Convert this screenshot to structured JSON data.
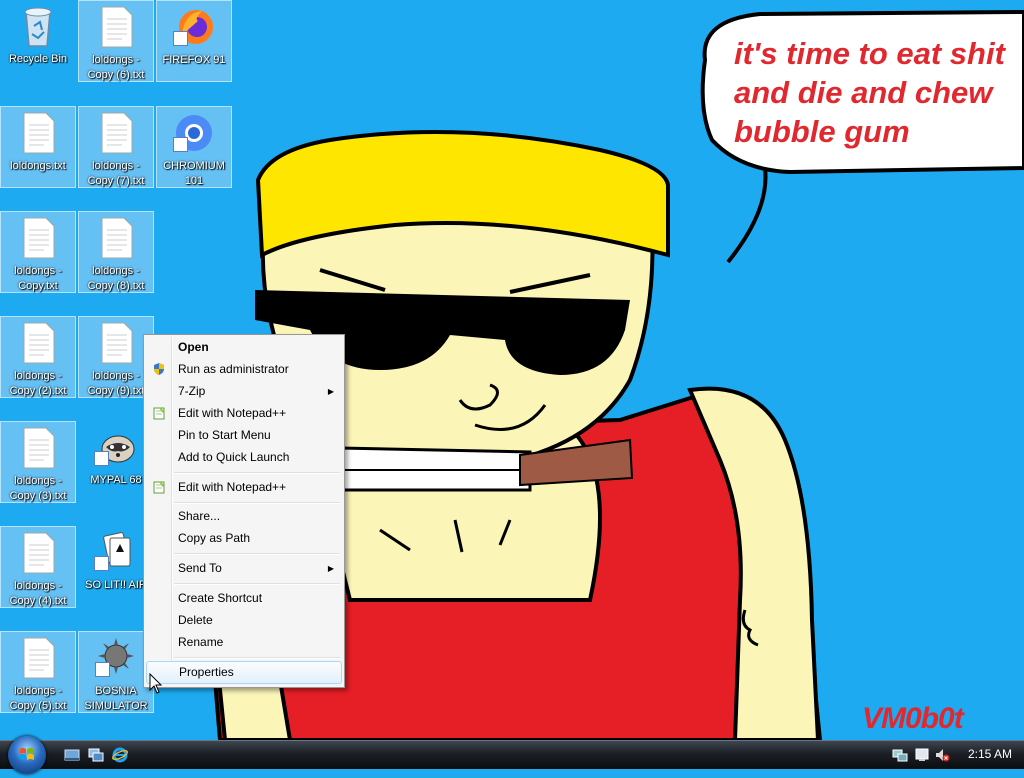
{
  "desktop": {
    "icons": [
      {
        "label": "Recycle Bin",
        "icon": "recycle-bin-icon"
      },
      {
        "label": "loldongs -\nCopy (6).txt",
        "icon": "text-file-icon"
      },
      {
        "label": "FIREFOX 91",
        "icon": "firefox-icon"
      },
      {
        "label": "loldongs.txt",
        "icon": "text-file-icon"
      },
      {
        "label": "loldongs -\nCopy (7).txt",
        "icon": "text-file-icon"
      },
      {
        "label": "CHROMIUM\n101",
        "icon": "chromium-icon"
      },
      {
        "label": "loldongs -\nCopy.txt",
        "icon": "text-file-icon"
      },
      {
        "label": "loldongs -\nCopy (8).txt",
        "icon": "text-file-icon"
      },
      {
        "label": "loldongs -\nCopy (2).txt",
        "icon": "text-file-icon"
      },
      {
        "label": "loldongs -\nCopy (9).txt",
        "icon": "text-file-icon"
      },
      {
        "label": "loldongs -\nCopy (3).txt",
        "icon": "text-file-icon"
      },
      {
        "label": "MYPAL 68",
        "icon": "raccoon-icon"
      },
      {
        "label": "loldongs -\nCopy (4).txt",
        "icon": "text-file-icon"
      },
      {
        "label": "SO LIT!! AIR",
        "icon": "cards-icon"
      },
      {
        "label": "loldongs -\nCopy (5).txt",
        "icon": "text-file-icon"
      },
      {
        "label": "BOSNIA\nSIMULATOR",
        "icon": "spiked-ball-icon"
      }
    ]
  },
  "wallpaper": {
    "speech_bubble": "it's time to eat shit\nand die and chew\nbubble gum",
    "signature": "VM0b0t",
    "text_color": "#e0282e"
  },
  "context_menu": {
    "items": [
      {
        "label": "Open",
        "bold": true
      },
      {
        "label": "Run as administrator",
        "icon": "uac-shield-icon"
      },
      {
        "label": "7-Zip",
        "submenu": true
      },
      {
        "label": "Edit with Notepad++",
        "icon": "notepad-plus-icon"
      },
      {
        "label": "Pin to Start Menu"
      },
      {
        "label": "Add to Quick Launch"
      },
      {
        "label": "Edit with Notepad++",
        "icon": "notepad-plus-icon"
      },
      {
        "label": "Share..."
      },
      {
        "label": "Copy as Path"
      },
      {
        "label": "Send To",
        "submenu": true
      },
      {
        "label": "Create Shortcut"
      },
      {
        "label": "Delete"
      },
      {
        "label": "Rename"
      },
      {
        "label": "Properties",
        "highlighted": true
      }
    ],
    "submenu_arrow": "▶"
  },
  "taskbar": {
    "clock": "2:15 AM",
    "quick_launch": [
      "show-desktop-icon",
      "switch-windows-icon",
      "internet-explorer-icon"
    ],
    "tray": [
      "network-icon",
      "action-center-icon",
      "volume-muted-icon"
    ]
  }
}
